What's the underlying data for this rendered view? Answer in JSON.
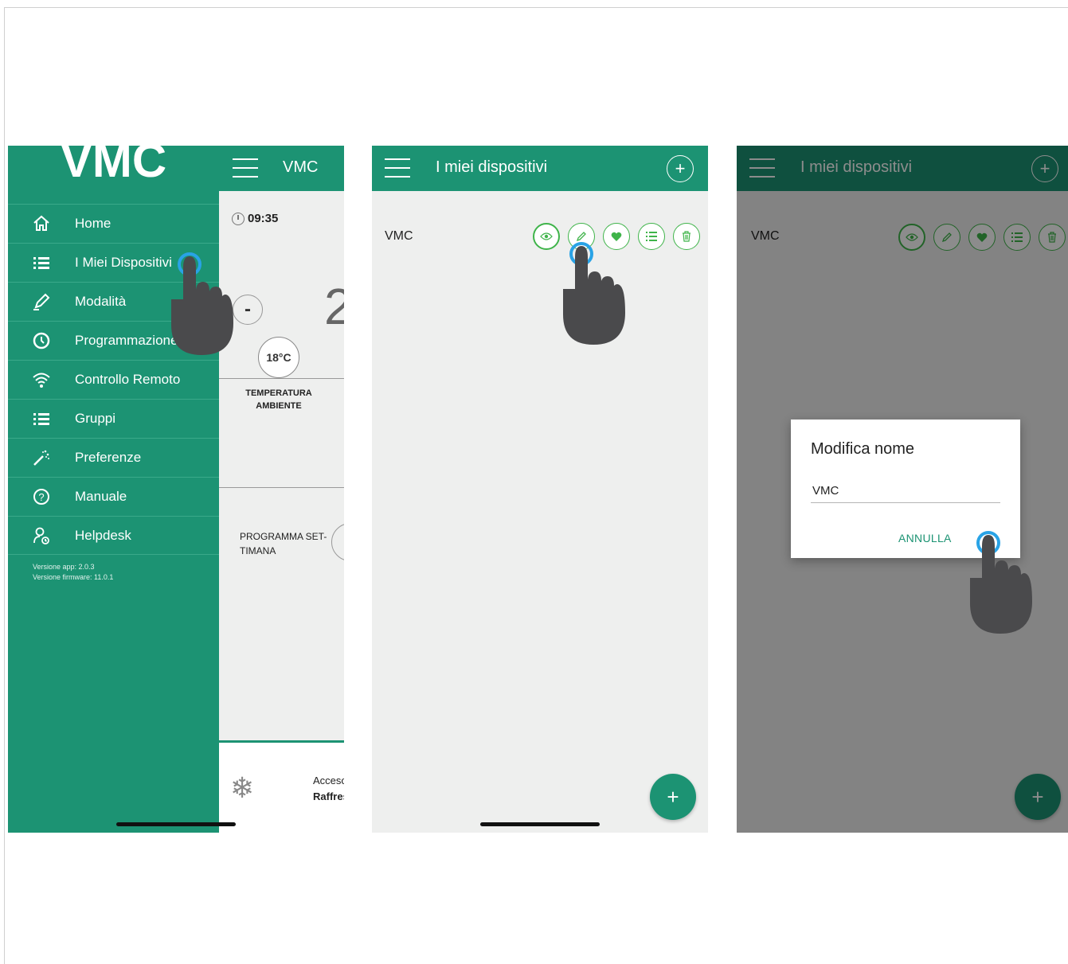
{
  "colors": {
    "primary": "#1c9373",
    "action": "#3fb44a",
    "tap_ring": "#29a3e6",
    "hand": "#4a4a4c"
  },
  "screen1": {
    "header_title": "VMC",
    "time": "09:35",
    "big_temp": "2",
    "ambient_temp": "18°C",
    "ambient_label": "TEMPERATURA AMBIENTE",
    "program_label": "PROGRAMMA SET-TIMANA",
    "mode_state": "Acceso",
    "mode_name": "Raffrescamento",
    "drawer": {
      "title": "VMC",
      "items": [
        {
          "label": "Home",
          "icon": "home-icon"
        },
        {
          "label": "I Miei Dispositivi",
          "icon": "list-icon"
        },
        {
          "label": "Modalità",
          "icon": "pencil-icon"
        },
        {
          "label": "Programmazione",
          "icon": "clock-icon"
        },
        {
          "label": "Controllo Remoto",
          "icon": "wifi-icon"
        },
        {
          "label": "Gruppi",
          "icon": "list-icon"
        },
        {
          "label": "Preferenze",
          "icon": "magic-wand-icon"
        },
        {
          "label": "Manuale",
          "icon": "question-icon"
        },
        {
          "label": "Helpdesk",
          "icon": "support-user-icon"
        }
      ],
      "app_version": "Versione app: 2.0.3",
      "firmware_version": "Versione firmware: 11.0.1"
    }
  },
  "screen2": {
    "header_title": "I miei dispositivi",
    "device_name": "VMC",
    "actions": [
      "eye-icon",
      "pencil-icon",
      "heart-icon",
      "list-icon",
      "trash-icon"
    ],
    "fab_label": "+"
  },
  "screen3": {
    "header_title": "I miei dispositivi",
    "device_name": "VMC",
    "dialog": {
      "title": "Modifica nome",
      "input_value": "VMC",
      "cancel_label": "ANNULLA"
    },
    "fab_label": "+"
  }
}
